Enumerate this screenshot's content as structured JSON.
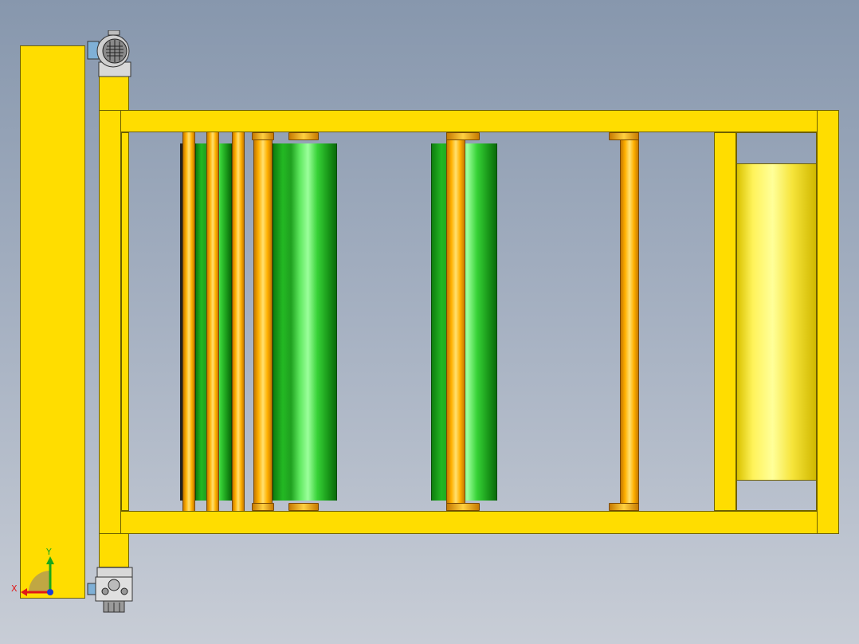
{
  "view": {
    "background_top": "#8797ad",
    "background_bottom": "#c8cdd6",
    "frame_color": "#ffdd00",
    "roller_color": "#23b823",
    "shaft_color": "#ffb000"
  },
  "triad": {
    "x_label": "X",
    "y_label": "Y",
    "icon": "coordinate-triad-icon"
  },
  "parts": {
    "motor_top": "gear-motor-icon",
    "motor_bottom": "gear-motor-icon"
  }
}
